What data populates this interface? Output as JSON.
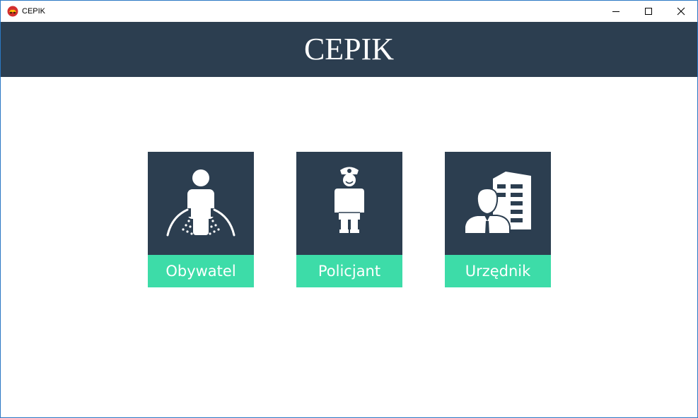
{
  "window": {
    "title": "CEPIK",
    "controls": [
      "minimize-icon",
      "maximize-icon",
      "close-icon"
    ]
  },
  "header": {
    "brand": "CEPIK"
  },
  "roles": [
    {
      "label": "Obywatel",
      "icon": "citizen-icon"
    },
    {
      "label": "Policjant",
      "icon": "police-officer-icon"
    },
    {
      "label": "Urzędnik",
      "icon": "clerk-building-icon"
    }
  ],
  "colors": {
    "header_bg": "#2c3e50",
    "tile_bg": "#2c3e50",
    "label_bg": "#3ddca8",
    "window_border": "#2b78c4"
  }
}
